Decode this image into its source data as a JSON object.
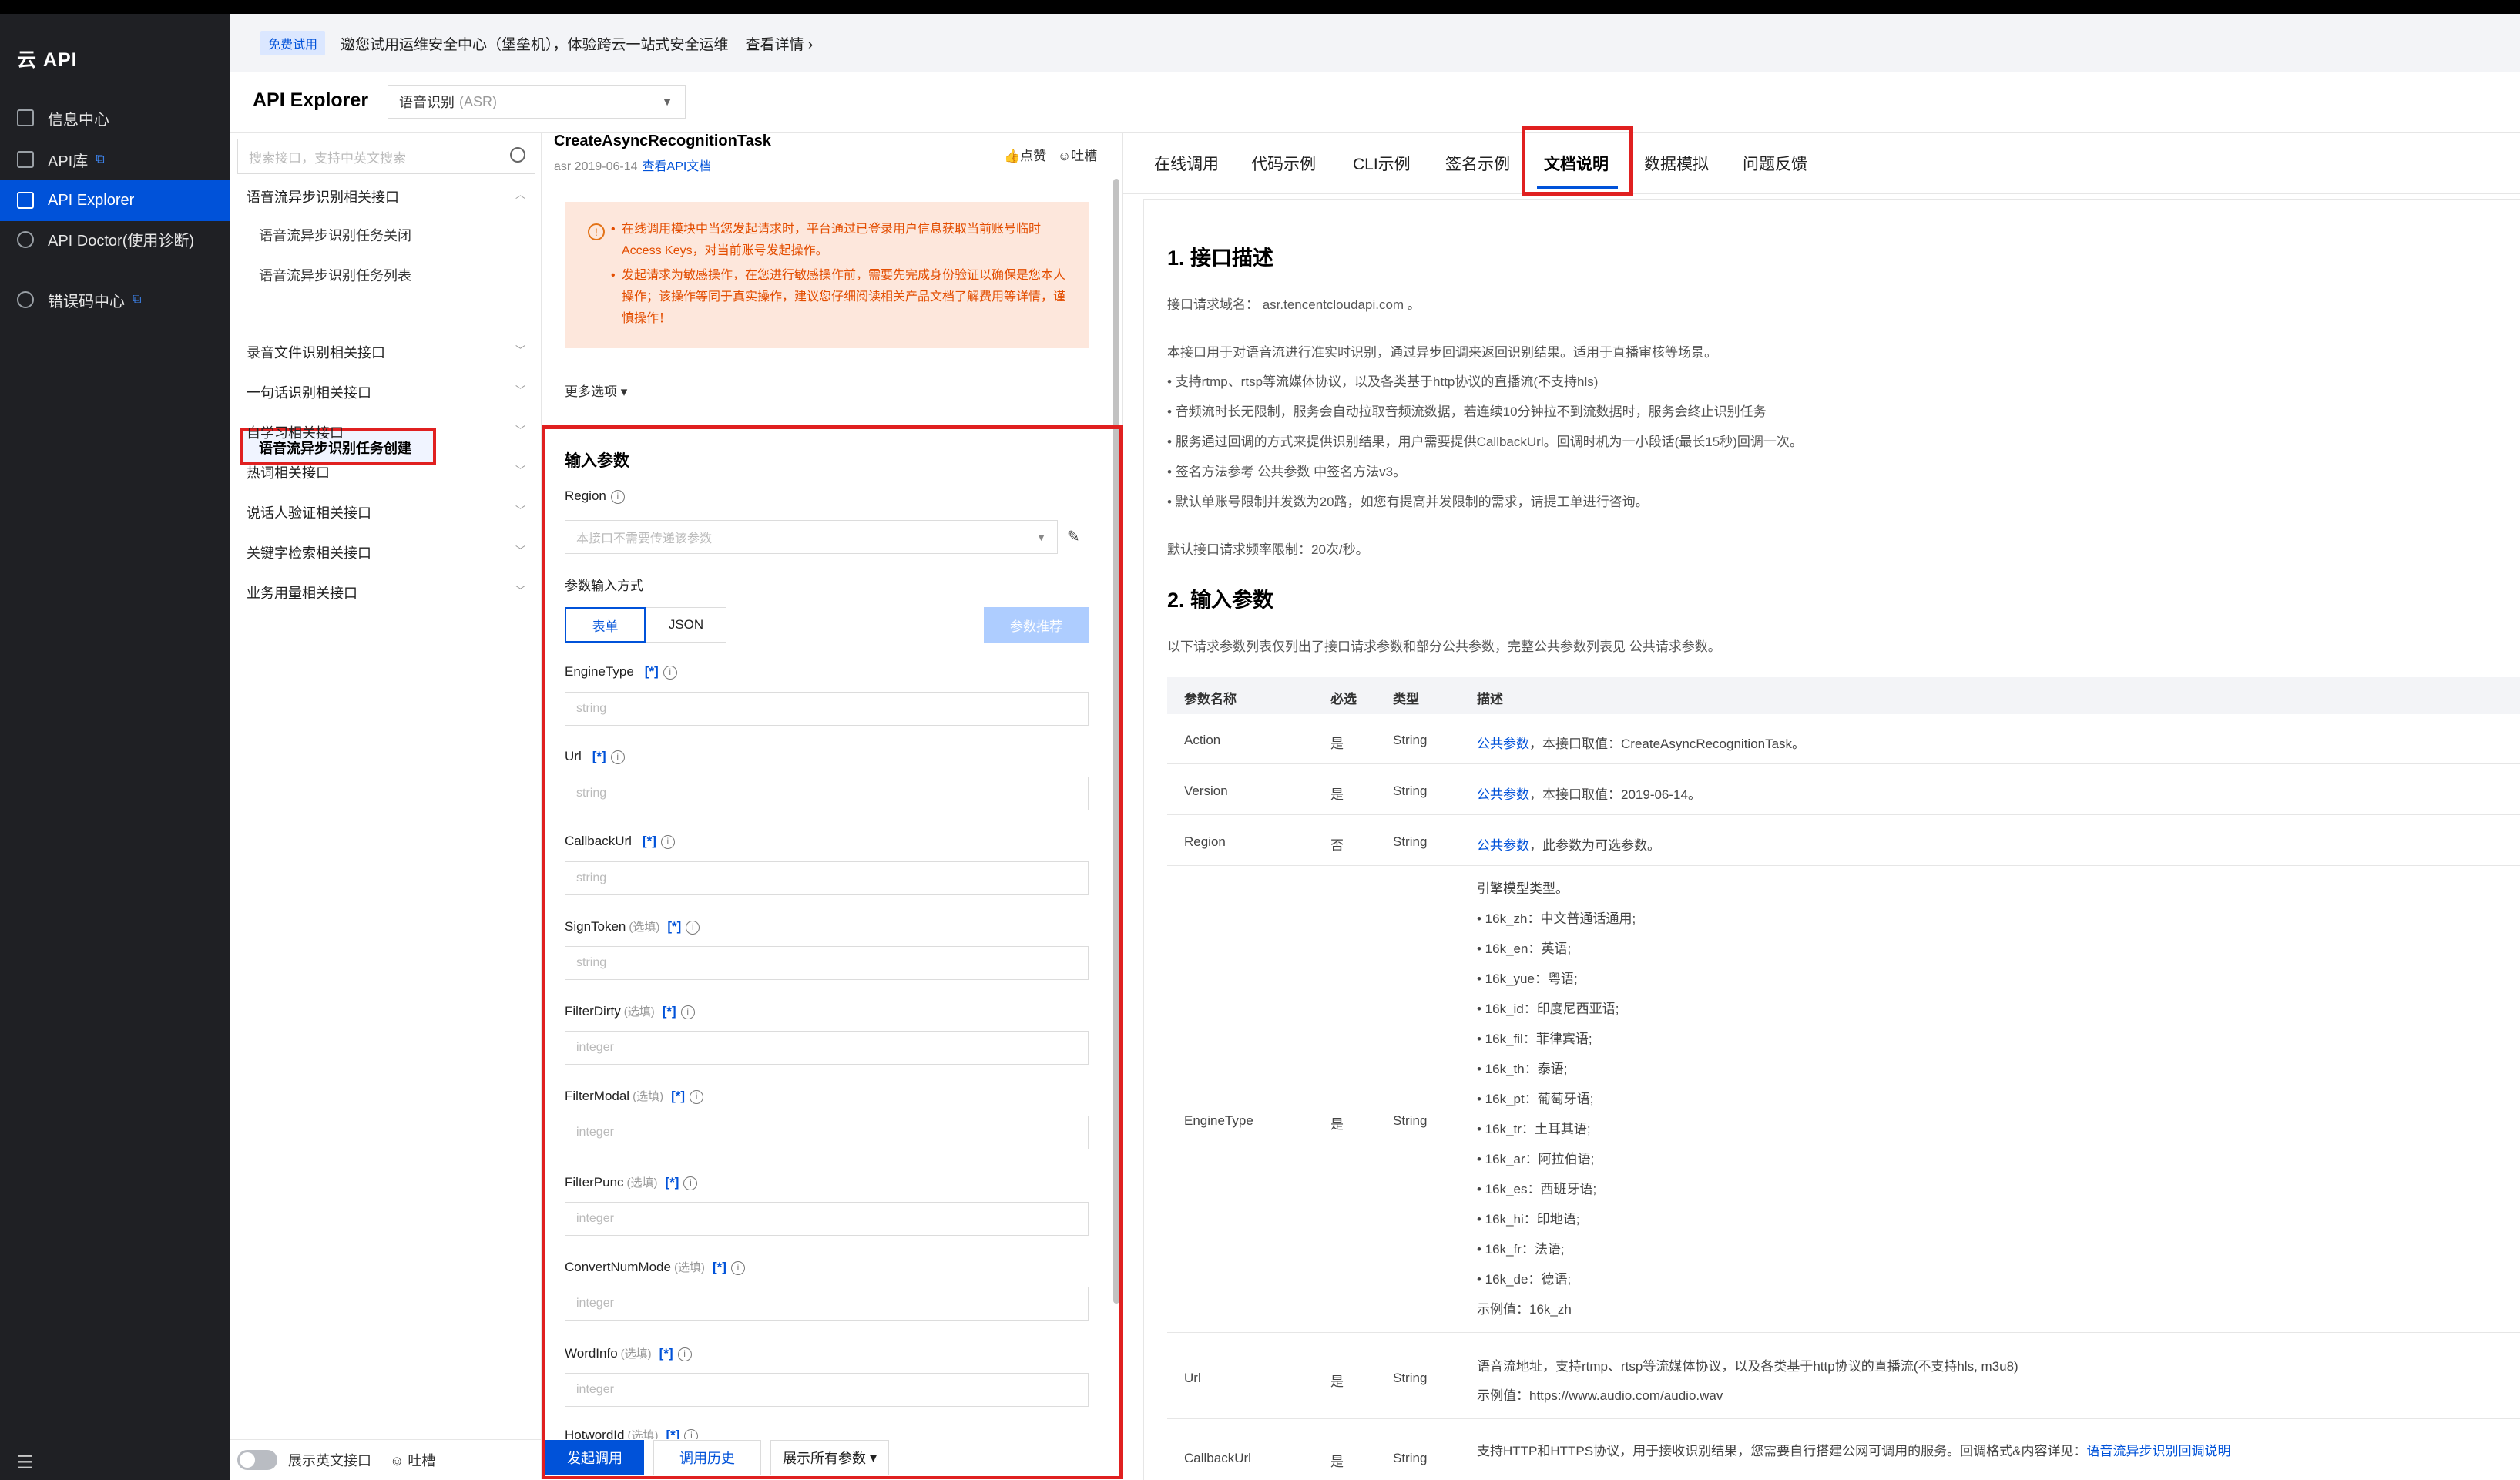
{
  "app": {
    "brand": "云 API"
  },
  "nav": {
    "items": [
      {
        "label": "信息中心",
        "external": false,
        "active": false
      },
      {
        "label": "API库",
        "external": true,
        "active": false
      },
      {
        "label": "API Explorer",
        "external": false,
        "active": true
      },
      {
        "label": "API Doctor(使用诊断)",
        "external": false,
        "active": false
      },
      {
        "label": "错误码中心",
        "external": true,
        "active": false
      }
    ],
    "collapse_icon": "menu-icon"
  },
  "notice": {
    "badge": "免费试用",
    "text": "邀您试用运维安全中心（堡垒机），体验跨云一站式安全运维",
    "detail": "查看详情"
  },
  "header": {
    "title": "API Explorer",
    "product": "语音识别",
    "product_sub": "(ASR)"
  },
  "api_list": {
    "search_placeholder": "搜索接口，支持中英文搜索",
    "groups": [
      {
        "label": "语音流异步识别相关接口",
        "expanded": true,
        "children": [
          "语音流异步识别任务关闭",
          "语音流异步识别任务列表",
          "语音流异步识别任务创建"
        ]
      },
      {
        "label": "录音文件识别相关接口"
      },
      {
        "label": "一句话识别相关接口"
      },
      {
        "label": "自学习相关接口"
      },
      {
        "label": "热词相关接口"
      },
      {
        "label": "说话人验证相关接口"
      },
      {
        "label": "关键字检索相关接口"
      },
      {
        "label": "业务用量相关接口"
      }
    ],
    "footer": {
      "toggle_label": "展示英文接口",
      "feedback": "吐槽"
    }
  },
  "middle": {
    "api_name": "CreateAsyncRecognitionTask",
    "version": "asr 2019-06-14",
    "doc_link": "查看API文档",
    "like": "点赞",
    "complain": "吐槽",
    "warnings": [
      "在线调用模块中当您发起请求时，平台通过已登录用户信息获取当前账号临时Access Keys，对当前账号发起操作。",
      "发起请求为敏感操作，在您进行敏感操作前，需要先完成身份验证以确保是您本人操作；该操作等同于真实操作，建议您仔细阅读相关产品文档了解费用等详情，谨慎操作！"
    ],
    "more_options": "更多选项",
    "input_title": "输入参数",
    "region_label": "Region",
    "region_placeholder": "本接口不需要传递该参数",
    "mode_label": "参数输入方式",
    "mode_tabs": [
      "表单",
      "JSON"
    ],
    "recommend": "参数推荐",
    "params": [
      {
        "name": "EngineType",
        "optional": "",
        "placeholder": "string"
      },
      {
        "name": "Url",
        "optional": "",
        "placeholder": "string"
      },
      {
        "name": "CallbackUrl",
        "optional": "",
        "placeholder": "string"
      },
      {
        "name": "SignToken",
        "optional": "(选填)",
        "placeholder": "string"
      },
      {
        "name": "FilterDirty",
        "optional": "(选填)",
        "placeholder": "integer"
      },
      {
        "name": "FilterModal",
        "optional": "(选填)",
        "placeholder": "integer"
      },
      {
        "name": "FilterPunc",
        "optional": "(选填)",
        "placeholder": "integer"
      },
      {
        "name": "ConvertNumMode",
        "optional": "(选填)",
        "placeholder": "integer"
      },
      {
        "name": "WordInfo",
        "optional": "(选填)",
        "placeholder": "integer"
      },
      {
        "name": "HotwordId",
        "optional": "(选填)",
        "placeholder": ""
      }
    ],
    "star": "[*]",
    "footer": {
      "call": "发起调用",
      "history": "调用历史",
      "show_all": "展示所有参数"
    }
  },
  "docs": {
    "tabs": [
      "在线调用",
      "代码示例",
      "CLI示例",
      "签名示例",
      "文档说明",
      "数据模拟",
      "问题反馈"
    ],
    "active_tab": "文档说明",
    "s1_title": "1. 接口描述",
    "domain": "接口请求域名： asr.tencentcloudapi.com 。",
    "desc": "本接口用于对语音流进行准实时识别，通过异步回调来返回识别结果。适用于直播审核等场景。",
    "bullets": [
      "支持rtmp、rtsp等流媒体协议，以及各类基于http协议的直播流(不支持hls)",
      "音频流时长无限制，服务会自动拉取音频流数据，若连续10分钟拉不到流数据时，服务会终止识别任务",
      "服务通过回调的方式来提供识别结果，用户需要提供CallbackUrl。回调时机为一小段话(最长15秒)回调一次。",
      "签名方法参考 公共参数 中签名方法v3。",
      "默认单账号限制并发数为20路，如您有提高并发限制的需求，请提工单进行咨询。"
    ],
    "freq": "默认接口请求频率限制：20次/秒。",
    "s2_title": "2. 输入参数",
    "s2_desc": "以下请求参数列表仅列出了接口请求参数和部分公共参数，完整公共参数列表见 公共请求参数。",
    "table_headers": [
      "参数名称",
      "必选",
      "类型",
      "描述"
    ],
    "rows": [
      {
        "name": "Action",
        "req": "是",
        "type": "String",
        "link": "公共参数",
        "desc": "，本接口取值：CreateAsyncRecognitionTask。"
      },
      {
        "name": "Version",
        "req": "是",
        "type": "String",
        "link": "公共参数",
        "desc": "，本接口取值：2019-06-14。"
      },
      {
        "name": "Region",
        "req": "否",
        "type": "String",
        "link": "公共参数",
        "desc": "，此参数为可选参数。"
      }
    ],
    "engine": {
      "name": "EngineType",
      "req": "是",
      "type": "String",
      "lines": [
        "引擎模型类型。",
        "• 16k_zh：中文普通话通用;",
        "• 16k_en：英语;",
        "• 16k_yue：粤语;",
        "• 16k_id：印度尼西亚语;",
        "• 16k_fil：菲律宾语;",
        "• 16k_th：泰语;",
        "• 16k_pt：葡萄牙语;",
        "• 16k_tr：土耳其语;",
        "• 16k_ar：阿拉伯语;",
        "• 16k_es：西班牙语;",
        "• 16k_hi：印地语;",
        "• 16k_fr：法语;",
        "• 16k_de：德语;",
        "示例值：16k_zh"
      ]
    },
    "url_row": {
      "name": "Url",
      "req": "是",
      "type": "String",
      "desc": "语音流地址，支持rtmp、rtsp等流媒体协议，以及各类基于http协议的直播流(不支持hls, m3u8)",
      "example": "示例值：https://www.audio.com/audio.wav"
    },
    "cb_row": {
      "name": "CallbackUrl",
      "req": "是",
      "type": "String",
      "desc": "支持HTTP和HTTPS协议，用于接收识别结果，您需要自行搭建公网可调用的服务。回调格式&内容详见：",
      "link": "语音流异步识别回调说明"
    }
  }
}
